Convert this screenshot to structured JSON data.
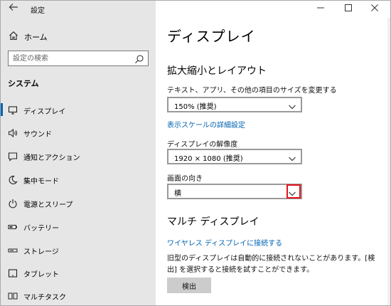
{
  "window": {
    "title": "設定"
  },
  "sidebar": {
    "home_label": "ホーム",
    "search_placeholder": "設定の検索",
    "section_label": "システム",
    "items": [
      {
        "label": "ディスプレイ",
        "icon": "monitor-icon",
        "active": true
      },
      {
        "label": "サウンド",
        "icon": "speaker-icon",
        "active": false
      },
      {
        "label": "通知とアクション",
        "icon": "notification-icon",
        "active": false
      },
      {
        "label": "集中モード",
        "icon": "moon-icon",
        "active": false
      },
      {
        "label": "電源とスリープ",
        "icon": "power-icon",
        "active": false
      },
      {
        "label": "バッテリー",
        "icon": "battery-icon",
        "active": false
      },
      {
        "label": "ストレージ",
        "icon": "storage-icon",
        "active": false
      },
      {
        "label": "タブレット",
        "icon": "tablet-icon",
        "active": false
      },
      {
        "label": "マルチタスク",
        "icon": "multitask-icon",
        "active": false
      }
    ]
  },
  "content": {
    "page_title": "ディスプレイ",
    "scale_group": {
      "title": "拡大縮小とレイアウト",
      "text_size_label": "テキスト、アプリ、その他の項目のサイズを変更する",
      "text_size_value": "150% (推奨)",
      "advanced_link": "表示スケールの詳細設定",
      "resolution_label": "ディスプレイの解像度",
      "resolution_value": "1920 × 1080 (推奨)",
      "orientation_label": "画面の向き",
      "orientation_value": "横"
    },
    "multi_group": {
      "title": "マルチ ディスプレイ",
      "wireless_link": "ワイヤレス ディスプレイに接続する",
      "description": "旧型のディスプレイは自動的に接続されないことがあります。[検出] を選択すると接続を試すことができます。",
      "detect_button": "検出"
    }
  },
  "colors": {
    "accent": "#0063b1",
    "sidebar_bg": "#e6e6e6",
    "highlight": "#e3141c"
  }
}
